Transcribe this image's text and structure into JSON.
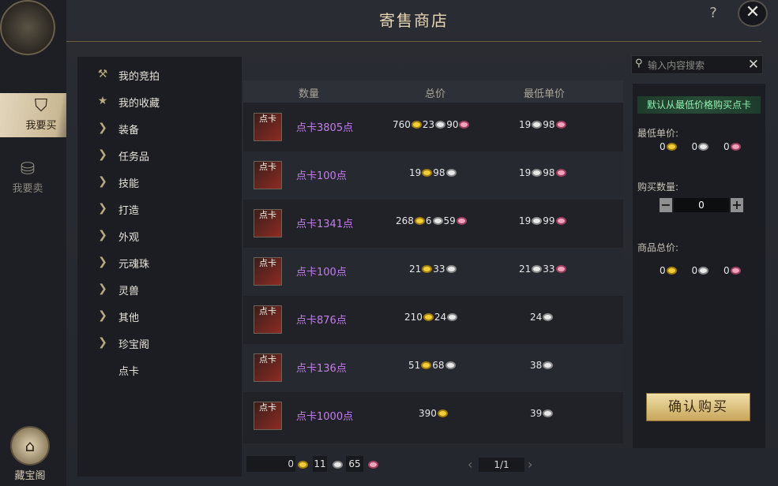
{
  "window": {
    "title": "寄售商店",
    "help_symbol": "?",
    "close_symbol": "✕"
  },
  "rail": {
    "buy_label": "我要买",
    "sell_label": "我要卖",
    "treasure_label": "藏宝阁"
  },
  "categories": [
    {
      "label": "我的竞拍",
      "icon": "gavel-icon"
    },
    {
      "label": "我的收藏",
      "icon": "star-icon"
    },
    {
      "label": "装备",
      "icon": "chevron-right-icon"
    },
    {
      "label": "任务品",
      "icon": "chevron-right-icon"
    },
    {
      "label": "技能",
      "icon": "chevron-right-icon"
    },
    {
      "label": "打造",
      "icon": "chevron-right-icon"
    },
    {
      "label": "外观",
      "icon": "chevron-right-icon"
    },
    {
      "label": "元魂珠",
      "icon": "chevron-right-icon"
    },
    {
      "label": "灵兽",
      "icon": "chevron-right-icon"
    },
    {
      "label": "其他",
      "icon": "chevron-right-icon"
    },
    {
      "label": "珍宝阁",
      "icon": "chevron-right-icon"
    },
    {
      "label": "点卡",
      "icon": ""
    }
  ],
  "table": {
    "headers": {
      "quantity": "数量",
      "total": "总价",
      "min_unit": "最低单价"
    },
    "icon_text": "点卡",
    "rows": [
      {
        "name": "点卡3805点",
        "total": {
          "gold": "760",
          "silver": "23",
          "copper": "90"
        },
        "unit": {
          "silver": "19",
          "copper": "98"
        }
      },
      {
        "name": "点卡100点",
        "total": {
          "gold": "19",
          "silver": "98"
        },
        "unit": {
          "silver": "19",
          "copper": "98"
        }
      },
      {
        "name": "点卡1341点",
        "total": {
          "gold": "268",
          "silver": "6",
          "copper": "59"
        },
        "unit": {
          "silver": "19",
          "copper": "99"
        }
      },
      {
        "name": "点卡100点",
        "total": {
          "gold": "21",
          "silver": "33"
        },
        "unit": {
          "silver": "21",
          "copper": "33"
        }
      },
      {
        "name": "点卡876点",
        "total": {
          "gold": "210",
          "silver": "24"
        },
        "unit": {
          "silver": "24"
        }
      },
      {
        "name": "点卡136点",
        "total": {
          "gold": "51",
          "silver": "68"
        },
        "unit": {
          "silver": "38"
        }
      },
      {
        "name": "点卡1000点",
        "total": {
          "gold": "390"
        },
        "unit": {
          "silver": "39"
        }
      }
    ]
  },
  "balance": {
    "gold": "0",
    "silver": "11",
    "copper": "65"
  },
  "pager": {
    "text": "1/1",
    "prev": "‹",
    "next": "›"
  },
  "search": {
    "placeholder": "输入内容搜索",
    "value": "",
    "clear": "✕"
  },
  "panel": {
    "hint": "默认从最低价格购买点卡",
    "min_unit_label": "最低单价:",
    "min_unit": {
      "gold": "0",
      "silver": "0",
      "copper": "0"
    },
    "qty_label": "购买数量:",
    "qty_value": "0",
    "minus": "−",
    "plus": "+",
    "total_label": "商品总价:",
    "total": {
      "gold": "0",
      "silver": "0",
      "copper": "0"
    },
    "confirm": "确认购买"
  },
  "colors": {
    "accent": "#e6d6b4",
    "item_name": "#c57df0",
    "hint_text": "#8ff0b0",
    "gold": "#f2cf3a",
    "silver": "#e8e8e8",
    "copper": "#f1a3bd"
  }
}
